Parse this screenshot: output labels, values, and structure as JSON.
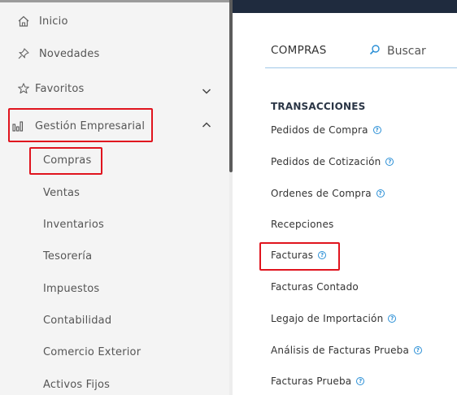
{
  "sidebar": {
    "items": [
      {
        "label": "Inicio",
        "icon": "home-icon"
      },
      {
        "label": "Novedades",
        "icon": "pin-icon"
      },
      {
        "label": "Favoritos",
        "icon": "star-icon",
        "chevron": "down"
      },
      {
        "label": "Gestión Empresarial",
        "icon": "bar-chart-icon",
        "chevron": "up",
        "highlighted": true
      }
    ],
    "subitems": [
      {
        "label": "Compras",
        "highlighted": true
      },
      {
        "label": "Ventas"
      },
      {
        "label": "Inventarios"
      },
      {
        "label": "Tesorería"
      },
      {
        "label": "Impuestos"
      },
      {
        "label": "Contabilidad"
      },
      {
        "label": "Comercio Exterior"
      },
      {
        "label": "Activos Fijos"
      }
    ]
  },
  "main": {
    "title": "COMPRAS",
    "search_label": "Buscar",
    "section": "TRANSACCIONES",
    "links": [
      {
        "label": "Pedidos de Compra",
        "help": true
      },
      {
        "label": "Pedidos de Cotización",
        "help": true
      },
      {
        "label": "Ordenes de Compra",
        "help": true
      },
      {
        "label": "Recepciones",
        "help": false
      },
      {
        "label": "Facturas",
        "help": true,
        "highlighted": true
      },
      {
        "label": "Facturas Contado",
        "help": false
      },
      {
        "label": "Legajo de Importación",
        "help": true
      },
      {
        "label": "Análisis de Facturas Prueba",
        "help": true
      },
      {
        "label": "Facturas Prueba",
        "help": true
      }
    ]
  },
  "colors": {
    "highlight": "#e0141e",
    "accent": "#2a8fd6",
    "topbar": "#1f2b3e"
  }
}
